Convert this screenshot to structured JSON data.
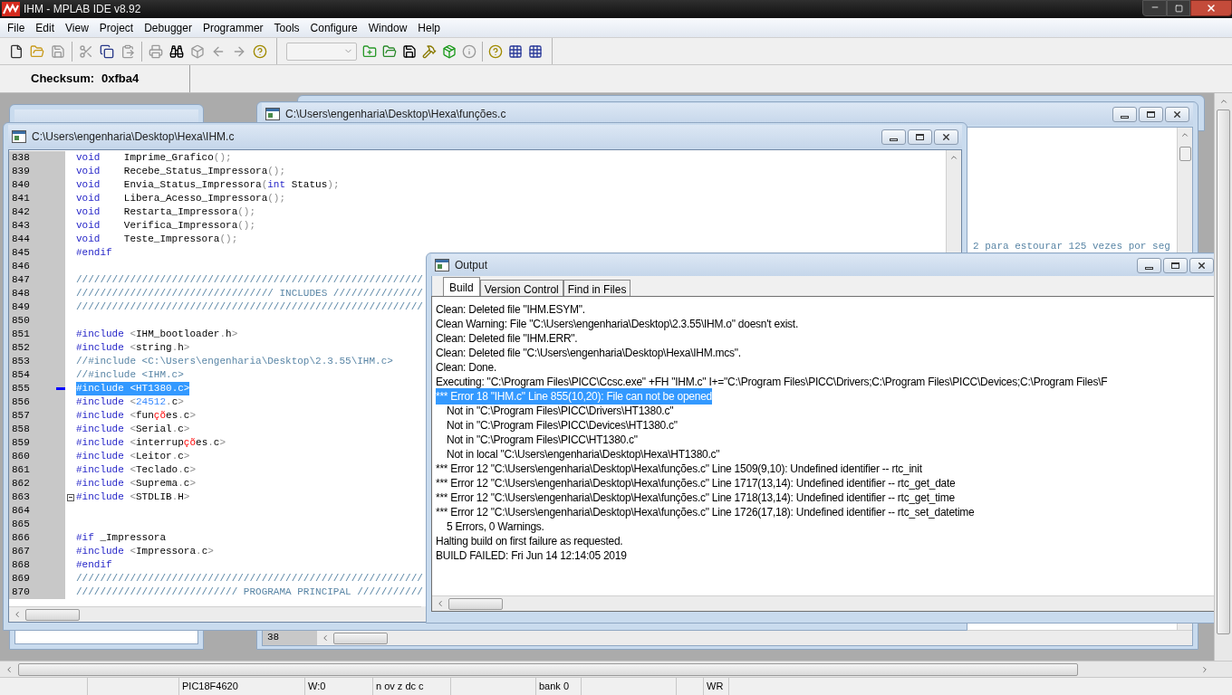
{
  "window": {
    "title": "IHM - MPLAB IDE v8.92"
  },
  "menu": [
    "File",
    "Edit",
    "View",
    "Project",
    "Debugger",
    "Programmer",
    "Tools",
    "Configure",
    "Window",
    "Help"
  ],
  "checksum": {
    "label": "Checksum:",
    "value": "0xfba4"
  },
  "back_window": {
    "title": "C:\\Users\\engenharia\\Desktop\\Hexa\\funções.c",
    "visible_text": "2 para estourar 125 vezes por seg",
    "line_number": "38"
  },
  "editor": {
    "title": "C:\\Users\\engenharia\\Desktop\\Hexa\\IHM.c",
    "lines": [
      {
        "number": "838",
        "selected": false,
        "marker": false,
        "fold": false,
        "tokens": [
          {
            "kind": "keyword",
            "text": "void"
          },
          {
            "kind": "plain",
            "text": "    Imprime_Grafico"
          },
          {
            "kind": "punct",
            "text": "();"
          }
        ]
      },
      {
        "number": "839",
        "selected": false,
        "marker": false,
        "fold": false,
        "tokens": [
          {
            "kind": "keyword",
            "text": "void"
          },
          {
            "kind": "plain",
            "text": "    Recebe_Status_Impressora"
          },
          {
            "kind": "punct",
            "text": "();"
          }
        ]
      },
      {
        "number": "840",
        "selected": false,
        "marker": false,
        "fold": false,
        "tokens": [
          {
            "kind": "keyword",
            "text": "void"
          },
          {
            "kind": "plain",
            "text": "    Envia_Status_Impressora"
          },
          {
            "kind": "punct",
            "text": "("
          },
          {
            "kind": "keyword",
            "text": "int"
          },
          {
            "kind": "plain",
            "text": " Status"
          },
          {
            "kind": "punct",
            "text": ");"
          }
        ]
      },
      {
        "number": "841",
        "selected": false,
        "marker": false,
        "fold": false,
        "tokens": [
          {
            "kind": "keyword",
            "text": "void"
          },
          {
            "kind": "plain",
            "text": "    Libera_Acesso_Impressora"
          },
          {
            "kind": "punct",
            "text": "();"
          }
        ]
      },
      {
        "number": "842",
        "selected": false,
        "marker": false,
        "fold": false,
        "tokens": [
          {
            "kind": "keyword",
            "text": "void"
          },
          {
            "kind": "plain",
            "text": "    Restarta_Impressora"
          },
          {
            "kind": "punct",
            "text": "();"
          }
        ]
      },
      {
        "number": "843",
        "selected": false,
        "marker": false,
        "fold": false,
        "tokens": [
          {
            "kind": "keyword",
            "text": "void"
          },
          {
            "kind": "plain",
            "text": "    Verifica_Impressora"
          },
          {
            "kind": "punct",
            "text": "();"
          }
        ]
      },
      {
        "number": "844",
        "selected": false,
        "marker": false,
        "fold": false,
        "tokens": [
          {
            "kind": "keyword",
            "text": "void"
          },
          {
            "kind": "plain",
            "text": "    Teste_Impressora"
          },
          {
            "kind": "punct",
            "text": "();"
          }
        ]
      },
      {
        "number": "845",
        "selected": false,
        "marker": false,
        "fold": false,
        "tokens": [
          {
            "kind": "keyword",
            "text": "#endif"
          }
        ]
      },
      {
        "number": "846",
        "selected": false,
        "marker": false,
        "fold": false
      },
      {
        "number": "847",
        "selected": false,
        "marker": false,
        "fold": false,
        "tokens": [
          {
            "kind": "comment",
            "text": "//////////////////////////////////////////////////////////"
          }
        ]
      },
      {
        "number": "848",
        "selected": false,
        "marker": false,
        "fold": false,
        "tokens": [
          {
            "kind": "comment",
            "text": "///////////////////////////////// INCLUDES ///////////////"
          }
        ]
      },
      {
        "number": "849",
        "selected": false,
        "marker": false,
        "fold": false,
        "tokens": [
          {
            "kind": "comment",
            "text": "//////////////////////////////////////////////////////////"
          }
        ]
      },
      {
        "number": "850",
        "selected": false,
        "marker": false,
        "fold": false
      },
      {
        "number": "851",
        "selected": false,
        "marker": false,
        "fold": false,
        "tokens": [
          {
            "kind": "keyword",
            "text": "#include"
          },
          {
            "kind": "punct",
            "text": " <"
          },
          {
            "kind": "plain",
            "text": "IHM_bootloader"
          },
          {
            "kind": "punct",
            "text": "."
          },
          {
            "kind": "plain",
            "text": "h"
          },
          {
            "kind": "punct",
            "text": ">"
          }
        ]
      },
      {
        "number": "852",
        "selected": false,
        "marker": false,
        "fold": false,
        "tokens": [
          {
            "kind": "keyword",
            "text": "#include"
          },
          {
            "kind": "punct",
            "text": " <"
          },
          {
            "kind": "plain",
            "text": "string"
          },
          {
            "kind": "punct",
            "text": "."
          },
          {
            "kind": "plain",
            "text": "h"
          },
          {
            "kind": "punct",
            "text": ">"
          }
        ]
      },
      {
        "number": "853",
        "selected": false,
        "marker": false,
        "fold": false,
        "tokens": [
          {
            "kind": "comment",
            "text": "//#include <C:\\Users\\engenharia\\Desktop\\2.3.55\\IHM.c>"
          }
        ]
      },
      {
        "number": "854",
        "selected": false,
        "marker": false,
        "fold": false,
        "tokens": [
          {
            "kind": "comment",
            "text": "//#include <IHM.c>"
          }
        ]
      },
      {
        "number": "855",
        "selected": true,
        "marker": true,
        "fold": false,
        "tokens": [
          {
            "kind": "keyword",
            "text": "#include"
          },
          {
            "kind": "punct",
            "text": " <"
          },
          {
            "kind": "plain",
            "text": "HT1380"
          },
          {
            "kind": "punct",
            "text": "."
          },
          {
            "kind": "plain",
            "text": "c"
          },
          {
            "kind": "punct",
            "text": ">"
          }
        ]
      },
      {
        "number": "856",
        "selected": false,
        "marker": false,
        "fold": false,
        "tokens": [
          {
            "kind": "keyword",
            "text": "#include"
          },
          {
            "kind": "punct",
            "text": " <"
          },
          {
            "kind": "number",
            "text": "24512"
          },
          {
            "kind": "punct",
            "text": "."
          },
          {
            "kind": "plain",
            "text": "c"
          },
          {
            "kind": "punct",
            "text": ">"
          }
        ]
      },
      {
        "number": "857",
        "selected": false,
        "marker": false,
        "fold": false,
        "tokens": [
          {
            "kind": "keyword",
            "text": "#include"
          },
          {
            "kind": "punct",
            "text": " <"
          },
          {
            "kind": "plain",
            "text": "fun"
          },
          {
            "kind": "accent",
            "text": "çõ"
          },
          {
            "kind": "plain",
            "text": "es"
          },
          {
            "kind": "punct",
            "text": "."
          },
          {
            "kind": "plain",
            "text": "c"
          },
          {
            "kind": "punct",
            "text": ">"
          }
        ]
      },
      {
        "number": "858",
        "selected": false,
        "marker": false,
        "fold": false,
        "tokens": [
          {
            "kind": "keyword",
            "text": "#include"
          },
          {
            "kind": "punct",
            "text": " <"
          },
          {
            "kind": "plain",
            "text": "Serial"
          },
          {
            "kind": "punct",
            "text": "."
          },
          {
            "kind": "plain",
            "text": "c"
          },
          {
            "kind": "punct",
            "text": ">"
          }
        ]
      },
      {
        "number": "859",
        "selected": false,
        "marker": false,
        "fold": false,
        "tokens": [
          {
            "kind": "keyword",
            "text": "#include"
          },
          {
            "kind": "punct",
            "text": " <"
          },
          {
            "kind": "plain",
            "text": "interrup"
          },
          {
            "kind": "accent",
            "text": "çõ"
          },
          {
            "kind": "plain",
            "text": "es"
          },
          {
            "kind": "punct",
            "text": "."
          },
          {
            "kind": "plain",
            "text": "c"
          },
          {
            "kind": "punct",
            "text": ">"
          }
        ]
      },
      {
        "number": "860",
        "selected": false,
        "marker": false,
        "fold": false,
        "tokens": [
          {
            "kind": "keyword",
            "text": "#include"
          },
          {
            "kind": "punct",
            "text": " <"
          },
          {
            "kind": "plain",
            "text": "Leitor"
          },
          {
            "kind": "punct",
            "text": "."
          },
          {
            "kind": "plain",
            "text": "c"
          },
          {
            "kind": "punct",
            "text": ">"
          }
        ]
      },
      {
        "number": "861",
        "selected": false,
        "marker": false,
        "fold": false,
        "tokens": [
          {
            "kind": "keyword",
            "text": "#include"
          },
          {
            "kind": "punct",
            "text": " <"
          },
          {
            "kind": "plain",
            "text": "Teclado"
          },
          {
            "kind": "punct",
            "text": "."
          },
          {
            "kind": "plain",
            "text": "c"
          },
          {
            "kind": "punct",
            "text": ">"
          }
        ]
      },
      {
        "number": "862",
        "selected": false,
        "marker": false,
        "fold": false,
        "tokens": [
          {
            "kind": "keyword",
            "text": "#include"
          },
          {
            "kind": "punct",
            "text": " <"
          },
          {
            "kind": "plain",
            "text": "Suprema"
          },
          {
            "kind": "punct",
            "text": "."
          },
          {
            "kind": "plain",
            "text": "c"
          },
          {
            "kind": "punct",
            "text": ">"
          }
        ]
      },
      {
        "number": "863",
        "selected": false,
        "marker": false,
        "fold": true,
        "tokens": [
          {
            "kind": "keyword",
            "text": "#include"
          },
          {
            "kind": "punct",
            "text": " <"
          },
          {
            "kind": "plain",
            "text": "STDLIB"
          },
          {
            "kind": "punct",
            "text": "."
          },
          {
            "kind": "plain",
            "text": "H"
          },
          {
            "kind": "punct",
            "text": ">"
          }
        ]
      },
      {
        "number": "864",
        "selected": false,
        "marker": false,
        "fold": false
      },
      {
        "number": "865",
        "selected": false,
        "marker": false,
        "fold": false
      },
      {
        "number": "866",
        "selected": false,
        "marker": false,
        "fold": false,
        "tokens": [
          {
            "kind": "keyword",
            "text": "#if"
          },
          {
            "kind": "plain",
            "text": " _Impressora"
          }
        ]
      },
      {
        "number": "867",
        "selected": false,
        "marker": false,
        "fold": false,
        "tokens": [
          {
            "kind": "keyword",
            "text": "#include"
          },
          {
            "kind": "punct",
            "text": " <"
          },
          {
            "kind": "plain",
            "text": "Impressora"
          },
          {
            "kind": "punct",
            "text": "."
          },
          {
            "kind": "plain",
            "text": "c"
          },
          {
            "kind": "punct",
            "text": ">"
          }
        ]
      },
      {
        "number": "868",
        "selected": false,
        "marker": false,
        "fold": false,
        "tokens": [
          {
            "kind": "keyword",
            "text": "#endif"
          }
        ]
      },
      {
        "number": "869",
        "selected": false,
        "marker": false,
        "fold": false,
        "tokens": [
          {
            "kind": "comment",
            "text": "//////////////////////////////////////////////////////////"
          }
        ]
      },
      {
        "number": "870",
        "selected": false,
        "marker": false,
        "fold": false,
        "tokens": [
          {
            "kind": "comment",
            "text": "/////////////////////////// PROGRAMA PRINCIPAL ///////////"
          }
        ]
      }
    ]
  },
  "output": {
    "title": "Output",
    "tabs": [
      {
        "label": "Build",
        "selected": true
      },
      {
        "label": "Version Control",
        "selected": false
      },
      {
        "label": "Find in Files",
        "selected": false
      }
    ],
    "lines": [
      {
        "text": "Clean: Deleted file \"IHM.ESYM\".",
        "selected": false,
        "indented": false
      },
      {
        "text": "Clean Warning: File \"C:\\Users\\engenharia\\Desktop\\2.3.55\\IHM.o\" doesn't exist.",
        "selected": false,
        "indented": false
      },
      {
        "text": "Clean: Deleted file \"IHM.ERR\".",
        "selected": false,
        "indented": false
      },
      {
        "text": "Clean: Deleted file \"C:\\Users\\engenharia\\Desktop\\Hexa\\IHM.mcs\".",
        "selected": false,
        "indented": false
      },
      {
        "text": "Clean: Done.",
        "selected": false,
        "indented": false
      },
      {
        "text": "Executing: \"C:\\Program Files\\PICC\\Ccsc.exe\" +FH \"IHM.c\" I+=\"C:\\Program Files\\PICC\\Drivers;C:\\Program Files\\PICC\\Devices;C:\\Program Files\\F",
        "selected": false,
        "indented": false
      },
      {
        "text": "*** Error 18 \"IHM.c\" Line 855(10,20): File can not be opened",
        "selected": true,
        "indented": false
      },
      {
        "text": "Not in \"C:\\Program Files\\PICC\\Drivers\\HT1380.c\"",
        "selected": false,
        "indented": true
      },
      {
        "text": "Not in \"C:\\Program Files\\PICC\\Devices\\HT1380.c\"",
        "selected": false,
        "indented": true
      },
      {
        "text": "Not in \"C:\\Program Files\\PICC\\HT1380.c\"",
        "selected": false,
        "indented": true
      },
      {
        "text": "Not in local \"C:\\Users\\engenharia\\Desktop\\Hexa\\HT1380.c\"",
        "selected": false,
        "indented": true
      },
      {
        "text": "*** Error 12 \"C:\\Users\\engenharia\\Desktop\\Hexa\\funções.c\" Line 1509(9,10): Undefined identifier  -- rtc_init",
        "selected": false,
        "indented": false
      },
      {
        "text": "*** Error 12 \"C:\\Users\\engenharia\\Desktop\\Hexa\\funções.c\" Line 1717(13,14): Undefined identifier  -- rtc_get_date",
        "selected": false,
        "indented": false
      },
      {
        "text": "*** Error 12 \"C:\\Users\\engenharia\\Desktop\\Hexa\\funções.c\" Line 1718(13,14): Undefined identifier  -- rtc_get_time",
        "selected": false,
        "indented": false
      },
      {
        "text": "*** Error 12 \"C:\\Users\\engenharia\\Desktop\\Hexa\\funções.c\" Line 1726(17,18): Undefined identifier  -- rtc_set_datetime",
        "selected": false,
        "indented": false
      },
      {
        "text": "5 Errors,  0 Warnings.",
        "selected": false,
        "indented": true
      },
      {
        "text": "Halting build on first failure as requested.",
        "selected": false,
        "indented": false
      },
      {
        "text": "BUILD FAILED: Fri Jun 14 12:14:05 2019",
        "selected": false,
        "indented": false
      }
    ]
  },
  "status_bar": [
    "PIC18F4620",
    "W:0",
    "n ov z dc c",
    "bank 0",
    "WR"
  ]
}
